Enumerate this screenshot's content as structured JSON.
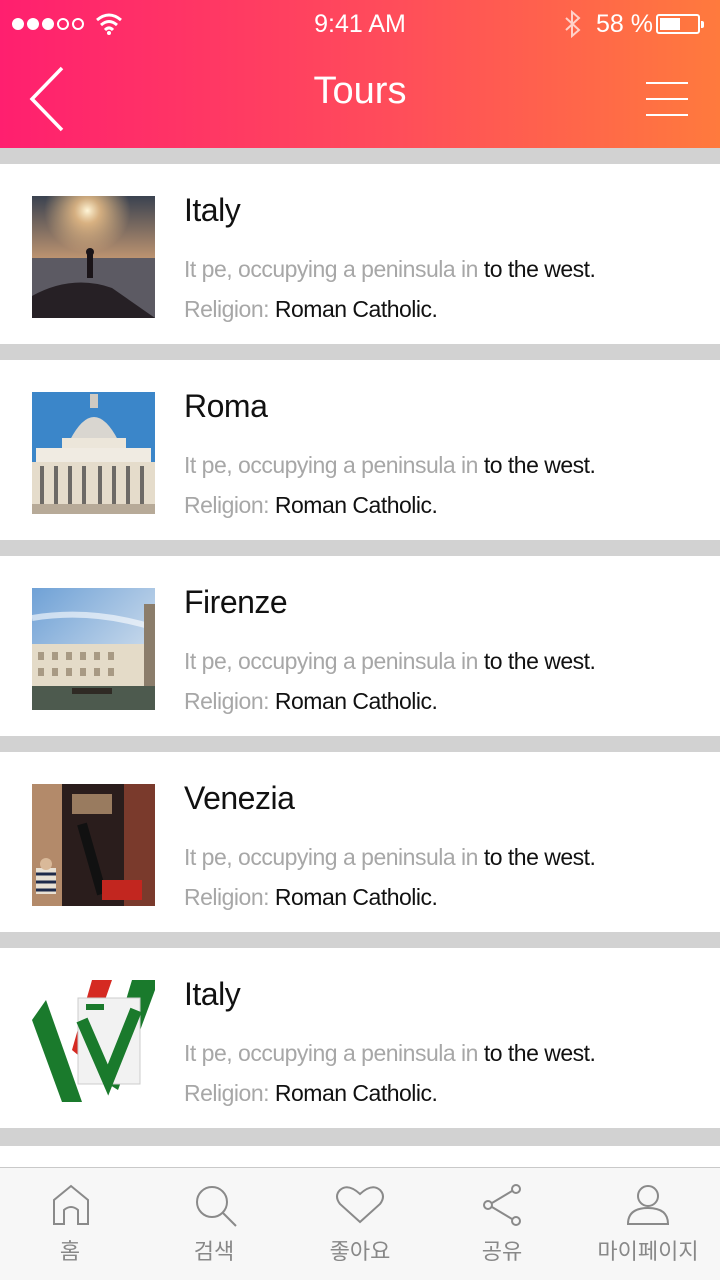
{
  "status_bar": {
    "time": "9:41 AM",
    "battery": "58 %"
  },
  "header": {
    "title": "Tours",
    "back_icon": "chevron-left-icon",
    "menu_icon": "hamburger-menu-icon"
  },
  "colors": {
    "gradient_start": "#ff1f6f",
    "gradient_end": "#ff7a3d",
    "separator": "#d2d2d2",
    "muted_text": "#a7a7a7"
  },
  "tours": [
    {
      "title": "Italy",
      "desc_muted": "It pe, occupying a peninsula in ",
      "desc_strong": "to the west.",
      "religion_label": "Religion: ",
      "religion_value": "Roman Catholic.",
      "thumb": "sunset-silhouette"
    },
    {
      "title": "Roma",
      "desc_muted": "It pe, occupying a peninsula in ",
      "desc_strong": "to the west.",
      "religion_label": "Religion: ",
      "religion_value": "Roman Catholic.",
      "thumb": "st-peters-basilica"
    },
    {
      "title": "Firenze",
      "desc_muted": "It pe, occupying a peninsula in ",
      "desc_strong": "to the west.",
      "religion_label": "Religion: ",
      "religion_value": "Roman Catholic.",
      "thumb": "canal-palazzo"
    },
    {
      "title": "Venezia",
      "desc_muted": "It pe, occupying a peninsula in ",
      "desc_strong": "to the west.",
      "religion_label": "Religion: ",
      "religion_value": "Roman Catholic.",
      "thumb": "venice-canal-gondola"
    },
    {
      "title": "Italy",
      "desc_muted": "It pe, occupying a peninsula in ",
      "desc_strong": "to the west.",
      "religion_label": "Religion: ",
      "religion_value": "Roman Catholic.",
      "thumb": "italy-flag-book"
    }
  ],
  "tabbar": {
    "home": "홈",
    "search": "검색",
    "like": "좋아요",
    "share": "공유",
    "mypage": "마이페이지"
  }
}
